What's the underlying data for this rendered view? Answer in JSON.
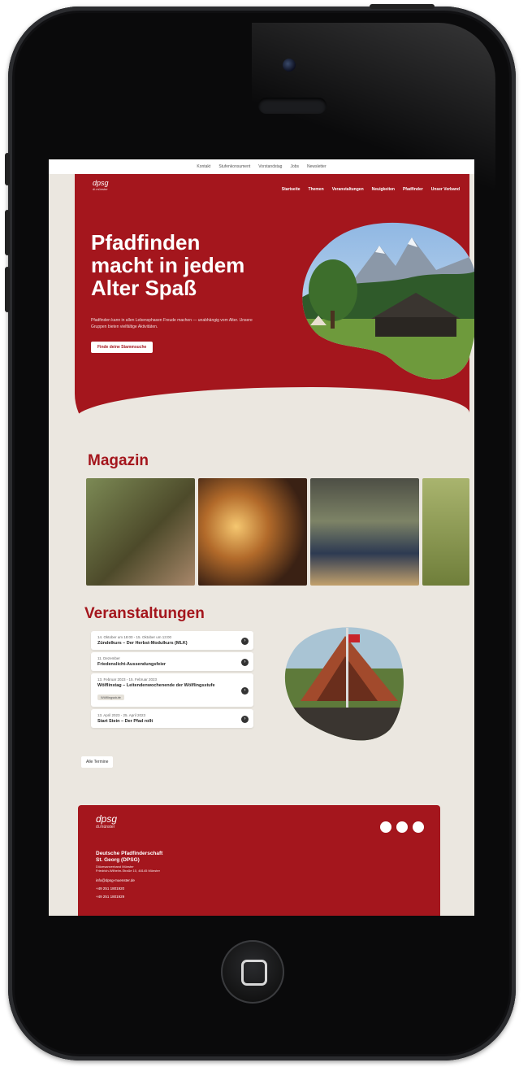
{
  "topbar": {
    "links": [
      "Kontakt",
      "Stufenkonsument",
      "Vorstandstag",
      "Jobs",
      "Newsletter"
    ]
  },
  "hero": {
    "logo": {
      "name": "dpsg",
      "sub": "di.münster"
    },
    "nav": [
      "Startseite",
      "Themen",
      "Veranstaltungen",
      "Neuigkeiten",
      "Pfadfinder",
      "Unser Verband"
    ],
    "title": "Pfadfinden macht in jedem Alter Spaß",
    "text": "Pfadfinden kann in allen Lebensphasen Freude machen — unabhängig vom Alter. Unsere Gruppen bieten vielfältige Aktivitäten.",
    "button": "Finde deine Stammsuche"
  },
  "magazine": {
    "title": "Magazin",
    "cards": [
      "card-1",
      "card-2",
      "card-3",
      "card-4"
    ]
  },
  "events": {
    "title": "Veranstaltungen",
    "items": [
      {
        "date": "14. Oktober um 18:00 - 15. Oktober um 13:00",
        "title": "Zündelkurs – Der Herbst-Modulkurs (MLK)",
        "tag": ""
      },
      {
        "date": "11. Dezember",
        "title": "Friedenslicht-Aussendungsfeier",
        "tag": ""
      },
      {
        "date": "13. Februar 2023 - 15. Februar 2023",
        "title": "Wölflinstag – Leitendenwochenende der Wölflingsstufe",
        "tag": "Wölflingsstufe"
      },
      {
        "date": "13. April 2023 - 25. April 2023",
        "title": "Start Stein – Der Pfad rollt",
        "tag": ""
      }
    ],
    "all_button": "Alle Termine"
  },
  "footer": {
    "logo": {
      "name": "dpsg",
      "sub": "di.münster"
    },
    "org_line1": "Deutsche Pfadfinderschaft",
    "org_line2": "St. Georg (DPSG)",
    "org_line3": "Diözesanverband Münster",
    "address": "Friedrich-Wilhelm-Straße 10, 48145 Münster",
    "email": "info@dpsg-muenster.de",
    "phone": "+49 251 1801920",
    "fax": "+49 251 1801929"
  },
  "colors": {
    "brand": "#a4161d",
    "bg": "#ebe7e0"
  }
}
